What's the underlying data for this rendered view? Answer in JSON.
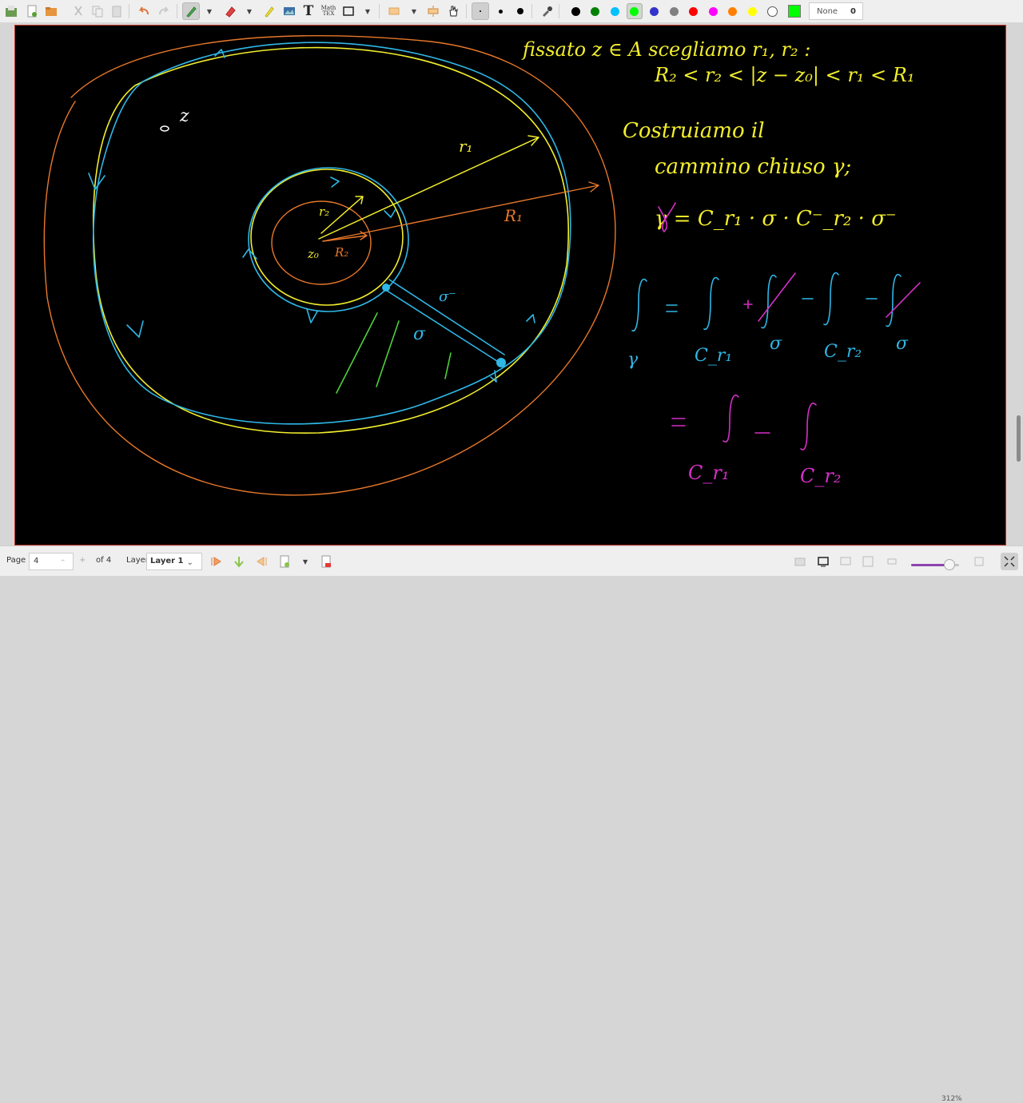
{
  "toolbar": {
    "tools": [
      "save-icon",
      "new-page-icon",
      "open-folder-icon",
      "cut-icon",
      "copy-icon",
      "paste-icon",
      "undo-icon",
      "redo-icon",
      "pen-icon",
      "eraser-icon",
      "highlighter-icon",
      "image-icon",
      "text-icon",
      "math-tex-icon",
      "shape-rectangle-icon",
      "fill-icon",
      "vertical-space-icon",
      "hand-icon"
    ],
    "math_tex_label_1": "Math",
    "math_tex_label_2": "TEX",
    "text_tool_glyph": "T",
    "stroke_sizes": [
      "fine",
      "medium",
      "thick"
    ],
    "colors": [
      "#000000",
      "#008000",
      "#00c0ff",
      "#00ff00",
      "#3333cc",
      "#808080",
      "#ff0000",
      "#ff00ff",
      "#ff8000",
      "#ffff00",
      "#ffffff"
    ],
    "selected_color": "#00ff00",
    "fill_label": "None",
    "fill_value": "0"
  },
  "statusbar": {
    "page_label": "Page",
    "page_value": "4",
    "page_total": "of 4",
    "layer_label": "Layer",
    "layer_value": "Layer 1",
    "zoom": "312%",
    "zoom_fraction": 0.8
  },
  "note": {
    "line1": "fissato z ∈ A scegliamo r₁, r₂ :",
    "line2": "R₂ < r₂ < |z − z₀| < r₁ < R₁",
    "line3": "Costruiamo il",
    "line4": "cammino chiuso γ;",
    "line5": "γ = C_r₁ · σ · C⁻_r₂ · σ⁻",
    "eq_int_gamma": "γ",
    "eq_cr1": "C_r₁",
    "eq_sigma": "σ",
    "eq_cr2": "C_r₂",
    "eq2_cr1": "C_r₁",
    "eq2_cr2": "C_r₂",
    "figure_z": "z",
    "figure_r1": "r₁",
    "figure_R1": "R₁",
    "figure_r2": "r₂",
    "figure_z0": "z₀",
    "figure_R2": "R₂",
    "figure_sigma": "σ",
    "figure_sigma_minus": "σ⁻"
  },
  "ink_colors": {
    "yellow": "#f2ee2c",
    "cyan": "#2fb7e6",
    "orange": "#e8782a",
    "magenta": "#d52fc8",
    "green": "#4fd13a",
    "white": "#ffffff"
  }
}
